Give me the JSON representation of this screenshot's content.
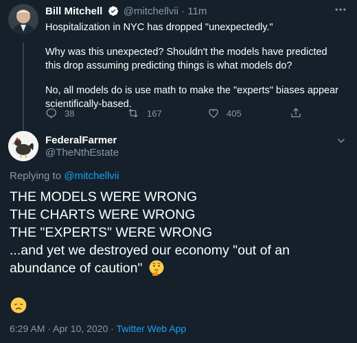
{
  "parent_tweet": {
    "name": "Bill Mitchell",
    "handle": "@mitchellvii",
    "separator": "·",
    "time": "11m",
    "paragraphs": [
      "Hospitalization in NYC has dropped \"unexpectedly.\"",
      "Why was this unexpected?  Shouldn't the models have predicted this drop assuming predicting things is what models do?",
      "No, all models do is use math to make the \"experts\" biases appear scientifically-based."
    ],
    "stats": {
      "replies": "38",
      "retweets": "167",
      "likes": "405"
    },
    "icons": [
      "verified-badge-icon",
      "more-icon",
      "reply-icon",
      "retweet-icon",
      "like-icon",
      "share-icon"
    ]
  },
  "reply_tweet": {
    "name": "FederalFarmer",
    "handle": "@TheNthEstate",
    "replying_prefix": "Replying to",
    "replying_to": "@mitchellvii",
    "lines": [
      "THE MODELS WERE WRONG",
      "THE CHARTS WERE WRONG",
      "THE \"EXPERTS\" WERE WRONG",
      "...and yet we destroyed our economy \"out of an abundance of caution\""
    ],
    "emoji_thinking": "thinking-face-emoji",
    "emoji_disappointed": "disappointed-face-emoji",
    "time": "6:29 AM",
    "dot1": "·",
    "date": "Apr 10, 2020",
    "dot2": "·",
    "source": "Twitter Web App"
  },
  "colors": {
    "background": "#15202b",
    "muted": "#8899a6",
    "link": "#1da1f2",
    "text": "#ffffff"
  }
}
